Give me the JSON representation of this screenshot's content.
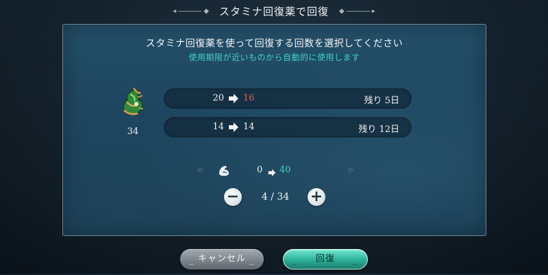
{
  "dialog": {
    "title": "スタミナ回復薬で回復",
    "instruction": "スタミナ回復薬を使って回復する回数を選択してください",
    "subtext": "使用期限が近いものから自動的に使用します"
  },
  "item": {
    "icon": "stamina-potion-icon",
    "count": "34"
  },
  "rows": [
    {
      "from": "20",
      "to": "16",
      "remaining": "残り 5日"
    },
    {
      "from": "14",
      "to": "14",
      "remaining": "残り 12日"
    }
  ],
  "stamina": {
    "icon": "stamina-arm-icon",
    "from": "0",
    "to": "40"
  },
  "stepper": {
    "value": "4 / 34"
  },
  "buttons": {
    "cancel": "キャンセル",
    "confirm": "回復"
  },
  "colors": {
    "accent_teal": "#3fd3c2",
    "decrease_red": "#e0624a",
    "panel_bg": "#1d4560"
  }
}
